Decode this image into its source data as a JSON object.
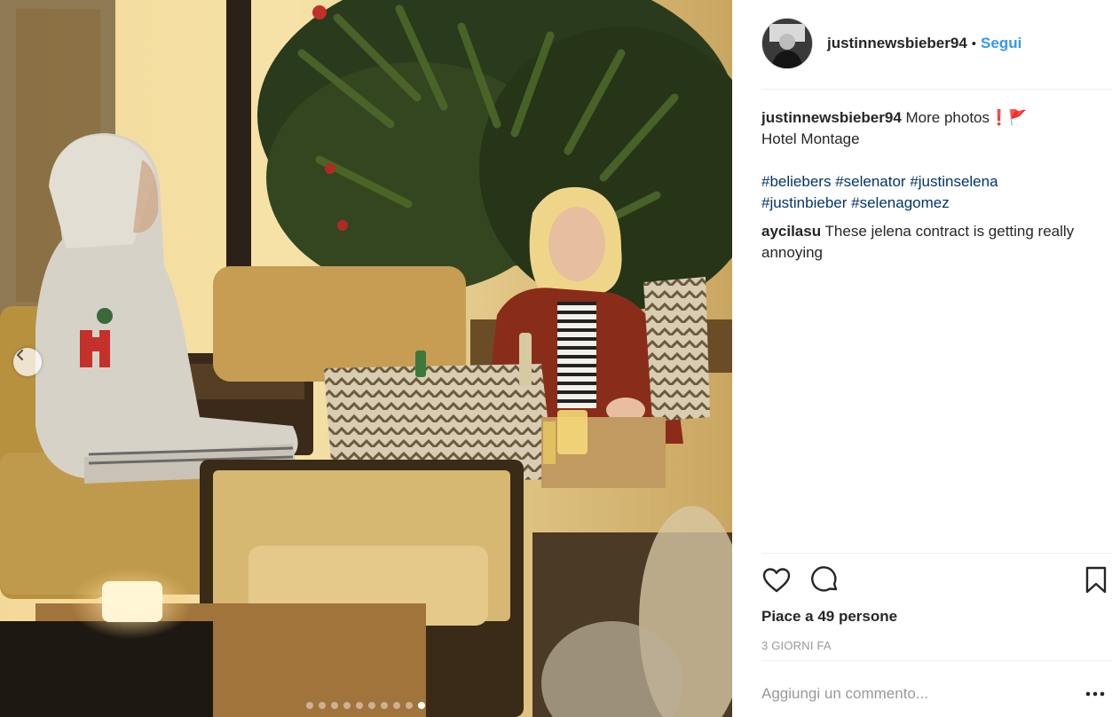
{
  "post": {
    "username": "justinnewsbieber94",
    "bullet": "•",
    "follow_label": "Segui",
    "caption": {
      "author": "justinnewsbieber94",
      "line1": "More photos",
      "line1_emoji": "❗🚩",
      "line2": "Hotel Montage",
      "hashtags": [
        "#beliebers",
        "#selenator",
        "#justinselena",
        "#justinbieber",
        "#selenagomez"
      ]
    },
    "comments": [
      {
        "author": "aycilasu",
        "text": "These jelena contract is getting really annoying"
      }
    ],
    "likes_text": "Piace a 49 persone",
    "time_text": "3 GIORNI FA",
    "add_comment_placeholder": "Aggiungi un commento...",
    "carousel": {
      "total": 10,
      "active_index": 9
    }
  },
  "icons": {
    "prev": "chevron-left-icon",
    "like": "heart-icon",
    "comment": "comment-bubble-icon",
    "save": "bookmark-icon",
    "more": "more-options-icon"
  },
  "colors": {
    "link": "#3897f0",
    "hashtag": "#003569",
    "muted": "#999999",
    "text": "#262626"
  }
}
